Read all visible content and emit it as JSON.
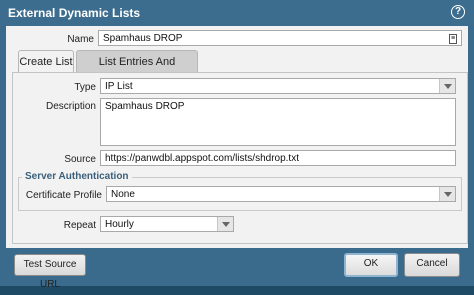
{
  "dialog": {
    "title": "External Dynamic Lists",
    "help_icon": "help-icon"
  },
  "name": {
    "label": "Name",
    "value": "Spamhaus DROP"
  },
  "tabs": [
    {
      "label": "Create List",
      "active": true
    },
    {
      "label": "List Entries And Exceptions",
      "active": false
    }
  ],
  "form": {
    "type": {
      "label": "Type",
      "value": "IP List"
    },
    "description": {
      "label": "Description",
      "value": "Spamhaus DROP"
    },
    "source": {
      "label": "Source",
      "value": "https://panwdbl.appspot.com/lists/shdrop.txt"
    },
    "server_auth": {
      "legend": "Server Authentication",
      "certificate_profile": {
        "label": "Certificate Profile",
        "value": "None"
      }
    },
    "repeat": {
      "label": "Repeat",
      "value": "Hourly"
    }
  },
  "footer": {
    "test_button": "Test Source URL",
    "ok_button": "OK",
    "cancel_button": "Cancel"
  }
}
